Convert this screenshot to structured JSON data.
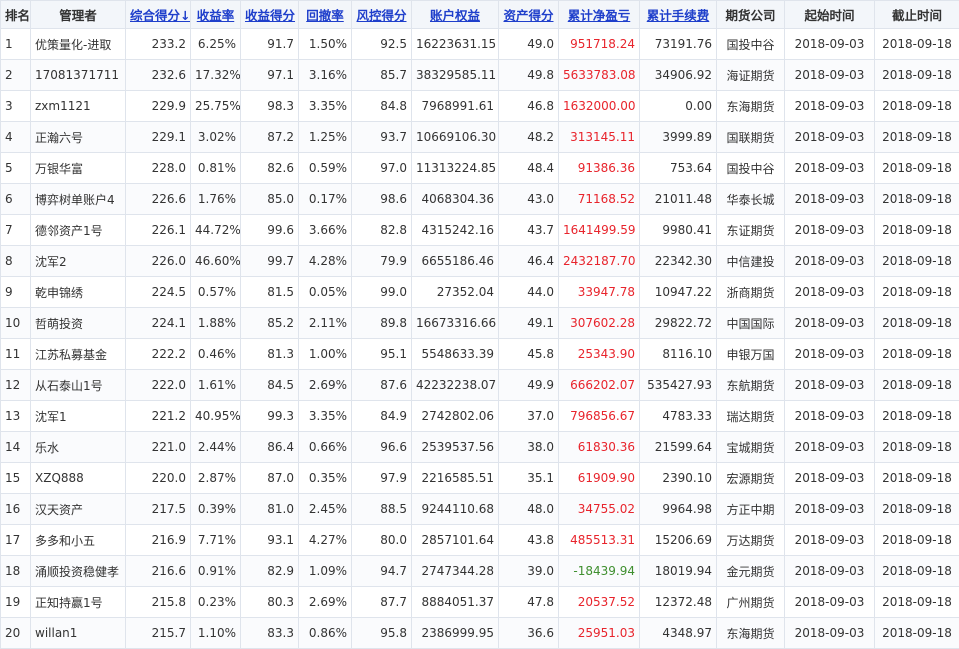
{
  "table": {
    "headers": [
      "排名",
      "管理者",
      "综合得分↓",
      "收益率",
      "收益得分",
      "回撤率",
      "风控得分",
      "账户权益",
      "资产得分",
      "累计净盈亏",
      "累计手续费",
      "期货公司",
      "起始时间",
      "截止时间"
    ],
    "rows": [
      [
        "1",
        "优策量化-进取",
        "233.2",
        "6.25%",
        "91.7",
        "1.50%",
        "92.5",
        "16223631.15",
        "49.0",
        "951718.24",
        "73191.76",
        "国投中谷",
        "2018-09-03",
        "2018-09-18"
      ],
      [
        "2",
        "17081371711",
        "232.6",
        "17.32%",
        "97.1",
        "3.16%",
        "85.7",
        "38329585.11",
        "49.8",
        "5633783.08",
        "34906.92",
        "海证期货",
        "2018-09-03",
        "2018-09-18"
      ],
      [
        "3",
        "zxm1121",
        "229.9",
        "25.75%",
        "98.3",
        "3.35%",
        "84.8",
        "7968991.61",
        "46.8",
        "1632000.00",
        "0.00",
        "东海期货",
        "2018-09-03",
        "2018-09-18"
      ],
      [
        "4",
        "正瀚六号",
        "229.1",
        "3.02%",
        "87.2",
        "1.25%",
        "93.7",
        "10669106.30",
        "48.2",
        "313145.11",
        "3999.89",
        "国联期货",
        "2018-09-03",
        "2018-09-18"
      ],
      [
        "5",
        "万银华富",
        "228.0",
        "0.81%",
        "82.6",
        "0.59%",
        "97.0",
        "11313224.85",
        "48.4",
        "91386.36",
        "753.64",
        "国投中谷",
        "2018-09-03",
        "2018-09-18"
      ],
      [
        "6",
        "博弈树单账户4",
        "226.6",
        "1.76%",
        "85.0",
        "0.17%",
        "98.6",
        "4068304.36",
        "43.0",
        "71168.52",
        "21011.48",
        "华泰长城",
        "2018-09-03",
        "2018-09-18"
      ],
      [
        "7",
        "德邻资产1号",
        "226.1",
        "44.72%",
        "99.6",
        "3.66%",
        "82.8",
        "4315242.16",
        "43.7",
        "1641499.59",
        "9980.41",
        "东证期货",
        "2018-09-03",
        "2018-09-18"
      ],
      [
        "8",
        "沈军2",
        "226.0",
        "46.60%",
        "99.7",
        "4.28%",
        "79.9",
        "6655186.46",
        "46.4",
        "2432187.70",
        "22342.30",
        "中信建投",
        "2018-09-03",
        "2018-09-18"
      ],
      [
        "9",
        "乾申锦绣",
        "224.5",
        "0.57%",
        "81.5",
        "0.05%",
        "99.0",
        "27352.04",
        "44.0",
        "33947.78",
        "10947.22",
        "浙商期货",
        "2018-09-03",
        "2018-09-18"
      ],
      [
        "10",
        "哲萌投资",
        "224.1",
        "1.88%",
        "85.2",
        "2.11%",
        "89.8",
        "16673316.66",
        "49.1",
        "307602.28",
        "29822.72",
        "中国国际",
        "2018-09-03",
        "2018-09-18"
      ],
      [
        "11",
        "江苏私募基金",
        "222.2",
        "0.46%",
        "81.3",
        "1.00%",
        "95.1",
        "5548633.39",
        "45.8",
        "25343.90",
        "8116.10",
        "申银万国",
        "2018-09-03",
        "2018-09-18"
      ],
      [
        "12",
        "从石泰山1号",
        "222.0",
        "1.61%",
        "84.5",
        "2.69%",
        "87.6",
        "42232238.07",
        "49.9",
        "666202.07",
        "535427.93",
        "东航期货",
        "2018-09-03",
        "2018-09-18"
      ],
      [
        "13",
        "沈军1",
        "221.2",
        "40.95%",
        "99.3",
        "3.35%",
        "84.9",
        "2742802.06",
        "37.0",
        "796856.67",
        "4783.33",
        "瑞达期货",
        "2018-09-03",
        "2018-09-18"
      ],
      [
        "14",
        "乐水",
        "221.0",
        "2.44%",
        "86.4",
        "0.66%",
        "96.6",
        "2539537.56",
        "38.0",
        "61830.36",
        "21599.64",
        "宝城期货",
        "2018-09-03",
        "2018-09-18"
      ],
      [
        "15",
        "XZQ888",
        "220.0",
        "2.87%",
        "87.0",
        "0.35%",
        "97.9",
        "2216585.51",
        "35.1",
        "61909.90",
        "2390.10",
        "宏源期货",
        "2018-09-03",
        "2018-09-18"
      ],
      [
        "16",
        "汉天资产",
        "217.5",
        "0.39%",
        "81.0",
        "2.45%",
        "88.5",
        "9244110.68",
        "48.0",
        "34755.02",
        "9964.98",
        "方正中期",
        "2018-09-03",
        "2018-09-18"
      ],
      [
        "17",
        "多多和小五",
        "216.9",
        "7.71%",
        "93.1",
        "4.27%",
        "80.0",
        "2857101.64",
        "43.8",
        "485513.31",
        "15206.69",
        "万达期货",
        "2018-09-03",
        "2018-09-18"
      ],
      [
        "18",
        "涌顺投资稳健孝",
        "216.6",
        "0.91%",
        "82.9",
        "1.09%",
        "94.7",
        "2747344.28",
        "39.0",
        "-18439.94",
        "18019.94",
        "金元期货",
        "2018-09-03",
        "2018-09-18"
      ],
      [
        "19",
        "正知持赢1号",
        "215.8",
        "0.23%",
        "80.3",
        "2.69%",
        "87.7",
        "8884051.37",
        "47.8",
        "20537.52",
        "12372.48",
        "广州期货",
        "2018-09-03",
        "2018-09-18"
      ],
      [
        "20",
        "willan1",
        "215.7",
        "1.10%",
        "83.3",
        "0.86%",
        "95.8",
        "2386999.95",
        "36.6",
        "25951.03",
        "4348.97",
        "东海期货",
        "2018-09-03",
        "2018-09-18"
      ]
    ]
  },
  "colors": {
    "header_link": "#1f3fcb",
    "profit_positive": "#e8242c",
    "profit_negative": "#3f8f2f",
    "border": "#dfe4ec"
  }
}
